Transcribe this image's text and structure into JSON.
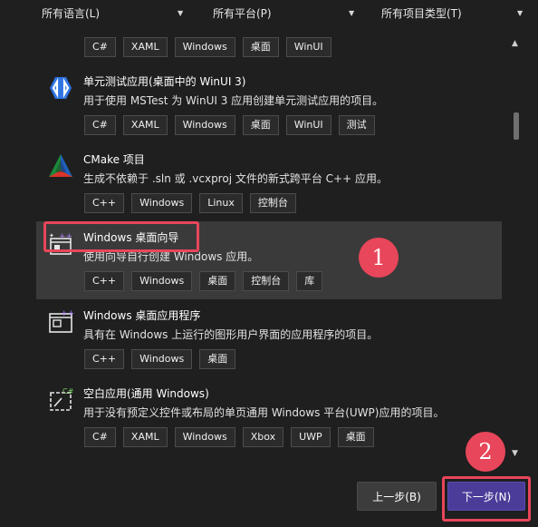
{
  "filters": {
    "language": "所有语言(L)",
    "platform": "所有平台(P)",
    "project_type": "所有项目类型(T)"
  },
  "templates": [
    {
      "name": "winui-partial",
      "title": "",
      "description": "",
      "icon": "none",
      "tags": [
        "C#",
        "XAML",
        "Windows",
        "桌面",
        "WinUI"
      ]
    },
    {
      "name": "unit-test-winui",
      "title": "单元测试应用(桌面中的 WinUI 3)",
      "description": "用于使用 MSTest 为 WinUI 3 应用创建单元测试应用的项目。",
      "icon": "winui-icon",
      "tags": [
        "C#",
        "XAML",
        "Windows",
        "桌面",
        "WinUI",
        "测试"
      ]
    },
    {
      "name": "cmake-project",
      "title": "CMake 项目",
      "description": "生成不依赖于 .sln 或 .vcxproj 文件的新式跨平台 C++ 应用。",
      "icon": "cmake-icon",
      "tags": [
        "C++",
        "Windows",
        "Linux",
        "控制台"
      ]
    },
    {
      "name": "windows-desktop-wizard",
      "title": "Windows 桌面向导",
      "description": "使用向导自行创建 Windows 应用。",
      "icon": "desktop-wizard-icon",
      "tags": [
        "C++",
        "Windows",
        "桌面",
        "控制台",
        "库"
      ]
    },
    {
      "name": "windows-desktop-app",
      "title": "Windows 桌面应用程序",
      "description": "具有在 Windows 上运行的图形用户界面的应用程序的项目。",
      "icon": "desktop-app-icon",
      "tags": [
        "C++",
        "Windows",
        "桌面"
      ]
    },
    {
      "name": "blank-uwp-app",
      "title": "空白应用(通用 Windows)",
      "description": "用于没有预定义控件或布局的单页通用 Windows 平台(UWP)应用的项目。",
      "icon": "uwp-icon",
      "tags": [
        "C#",
        "XAML",
        "Windows",
        "Xbox",
        "UWP",
        "桌面"
      ]
    }
  ],
  "buttons": {
    "back": "上一步(B)",
    "next": "下一步(N)"
  },
  "annotations": {
    "badge1": "1",
    "badge2": "2"
  },
  "colors": {
    "accent": "#4b3c99",
    "highlight": "#e8465a",
    "selected_row": "#3a3a3a",
    "background": "#1f1f1f"
  }
}
